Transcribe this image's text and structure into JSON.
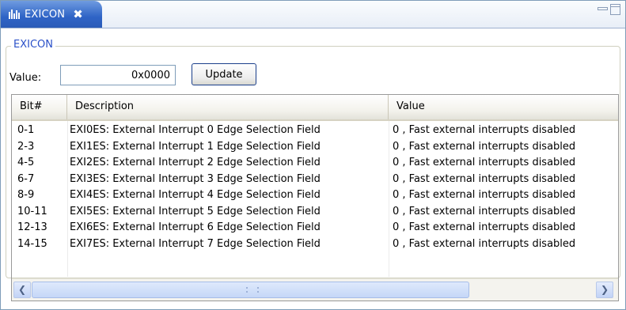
{
  "tab": {
    "title": "EXICON",
    "close_glyph": "✖",
    "icon": "register-bars-icon"
  },
  "group": {
    "label": "EXICON"
  },
  "value_field": {
    "label": "Value:",
    "value": "0x0000"
  },
  "update_button": {
    "label": "Update"
  },
  "table": {
    "columns": [
      "Bit#",
      "Description",
      "Value"
    ],
    "rows": [
      {
        "bit": "0-1",
        "description": "EXI0ES: External Interrupt 0 Edge Selection Field",
        "value": "0 , Fast external interrupts disabled"
      },
      {
        "bit": "2-3",
        "description": "EXI1ES: External Interrupt 1 Edge Selection Field",
        "value": "0 , Fast external interrupts disabled"
      },
      {
        "bit": "4-5",
        "description": "EXI2ES: External Interrupt 2 Edge Selection Field",
        "value": "0 , Fast external interrupts disabled"
      },
      {
        "bit": "6-7",
        "description": "EXI3ES: External Interrupt 3 Edge Selection Field",
        "value": "0 , Fast external interrupts disabled"
      },
      {
        "bit": "8-9",
        "description": "EXI4ES: External Interrupt 4 Edge Selection Field",
        "value": "0 , Fast external interrupts disabled"
      },
      {
        "bit": "10-11",
        "description": "EXI5ES: External Interrupt 5 Edge Selection Field",
        "value": "0 , Fast external interrupts disabled"
      },
      {
        "bit": "12-13",
        "description": "EXI6ES: External Interrupt 6 Edge Selection Field",
        "value": "0 , Fast external interrupts disabled"
      },
      {
        "bit": "14-15",
        "description": "EXI7ES: External Interrupt 7 Edge Selection Field",
        "value": "0 , Fast external interrupts disabled"
      }
    ]
  },
  "scrollbar": {
    "left_glyph": "❮",
    "right_glyph": "❯"
  },
  "colors": {
    "tab_blue": "#2f64c6",
    "group_label": "#2a50c8",
    "border": "#7f9db9"
  }
}
